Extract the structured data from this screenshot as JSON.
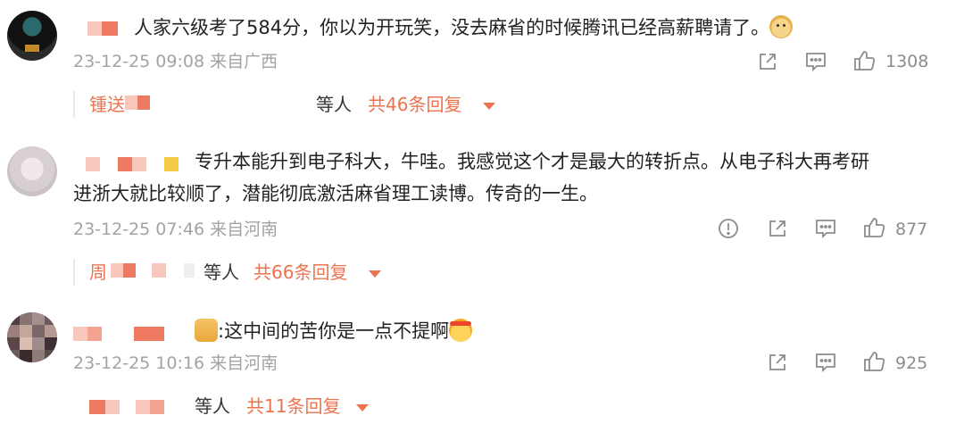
{
  "comments": [
    {
      "text": "人家六级考了584分，你以为开玩笑，没去麻省的时候腾讯已经高薪聘请了。",
      "emoji": "doge-emoji",
      "meta": "23-12-25 09:08 来自广西",
      "likes": "1308",
      "reply": {
        "name_prefix": "锺送",
        "middle": "等人",
        "total": "共46条回复"
      }
    },
    {
      "text_line1": "专升本能升到电子科大，牛哇。我感觉这个才是最大的转折点。从电子科大再考研",
      "text_line2": "进浙大就比较顺了，潜能彻底激活麻省理工读博。传奇的一生。",
      "meta": "23-12-25 07:46 来自河南",
      "likes": "877",
      "reply": {
        "name_prefix": "周",
        "middle": "等人",
        "total": "共66条回复"
      }
    },
    {
      "text": ":这中间的苦你是一点不提啊",
      "emoji_before": "pray-emoji",
      "emoji_after": "fighting-emoji",
      "meta": "23-12-25 10:16 来自河南",
      "likes": "925",
      "reply": {
        "middle": "等人",
        "total": "共11条回复"
      }
    }
  ],
  "colors": {
    "accent": "#eb7350",
    "meta": "#a3a3a3",
    "text": "#222222"
  },
  "icons": [
    "share-icon",
    "comment-icon",
    "like-icon",
    "report-icon",
    "caret-down-icon"
  ]
}
